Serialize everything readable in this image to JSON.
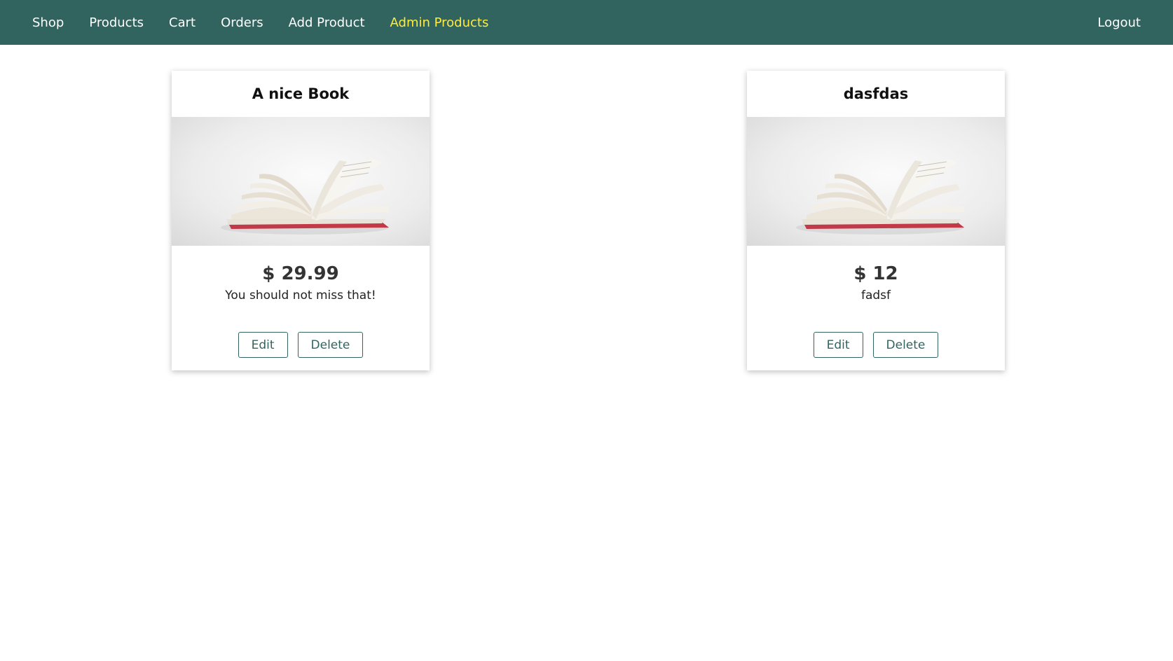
{
  "nav": {
    "left_items": [
      {
        "label": "Shop"
      },
      {
        "label": "Products"
      },
      {
        "label": "Cart"
      },
      {
        "label": "Orders"
      },
      {
        "label": "Add Product"
      },
      {
        "label": "Admin Products"
      }
    ],
    "active": "Admin Products",
    "logout": "Logout"
  },
  "products": [
    {
      "title": "A nice Book",
      "image_icon": "open-book-image",
      "price": "$ 29.99",
      "description": "You should not miss that!",
      "edit_label": "Edit",
      "delete_label": "Delete"
    },
    {
      "title": "dasfdas",
      "image_icon": "open-book-image",
      "price": "$ 12",
      "description": "fadsf",
      "edit_label": "Edit",
      "delete_label": "Delete"
    }
  ],
  "colors": {
    "navbar": "#32645f",
    "active_link": "#ffeb3b",
    "button_text": "#32645f"
  }
}
